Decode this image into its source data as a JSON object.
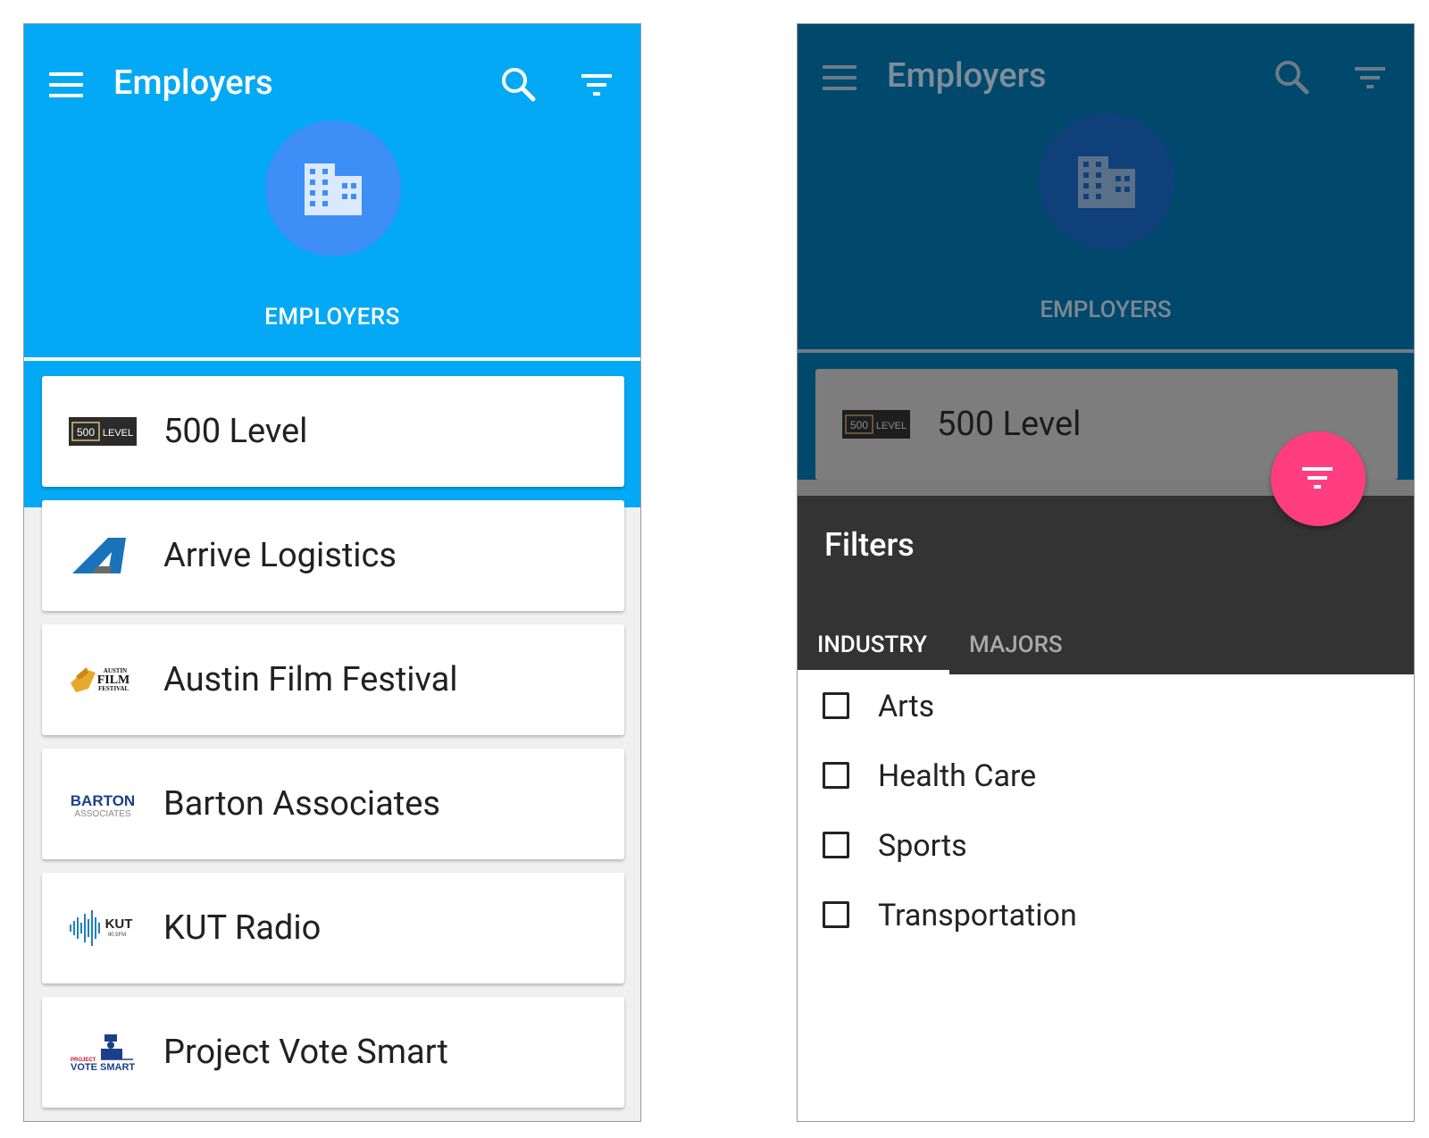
{
  "left": {
    "appbar": {
      "title": "Employers",
      "tab_label": "EMPLOYERS",
      "color": "#03a9f4"
    },
    "employers": [
      {
        "name": "500 Level",
        "logo": "500-level-logo",
        "logo_text": [
          "500",
          "LEVEL"
        ]
      },
      {
        "name": "Arrive Logistics",
        "logo": "arrive-logistics-logo"
      },
      {
        "name": "Austin Film Festival",
        "logo": "austin-film-festival-logo",
        "logo_text": [
          "AUSTIN",
          "FILM",
          "FESTIVAL"
        ]
      },
      {
        "name": "Barton Associates",
        "logo": "barton-associates-logo",
        "logo_text": [
          "BARTON",
          "ASSOCIATES"
        ]
      },
      {
        "name": "KUT Radio",
        "logo": "kut-radio-logo",
        "logo_text": [
          "KUT",
          "90.5FM"
        ]
      },
      {
        "name": "Project Vote Smart",
        "logo": "project-vote-smart-logo",
        "logo_text": [
          "PROJECT",
          "VOTE SMART"
        ]
      }
    ]
  },
  "right": {
    "appbar": {
      "title": "Employers",
      "tab_label": "EMPLOYERS"
    },
    "preview_card": {
      "name": "500 Level",
      "logo_text": [
        "500",
        "LEVEL"
      ]
    },
    "filters": {
      "title": "Filters",
      "tabs": [
        {
          "label": "INDUSTRY",
          "active": true
        },
        {
          "label": "MAJORS",
          "active": false
        }
      ],
      "options": [
        {
          "label": "Arts",
          "checked": false
        },
        {
          "label": "Health Care",
          "checked": false
        },
        {
          "label": "Sports",
          "checked": false
        },
        {
          "label": "Transportation",
          "checked": false
        }
      ]
    },
    "fab": {
      "icon": "filter-icon",
      "color": "#ff3d7f"
    }
  }
}
